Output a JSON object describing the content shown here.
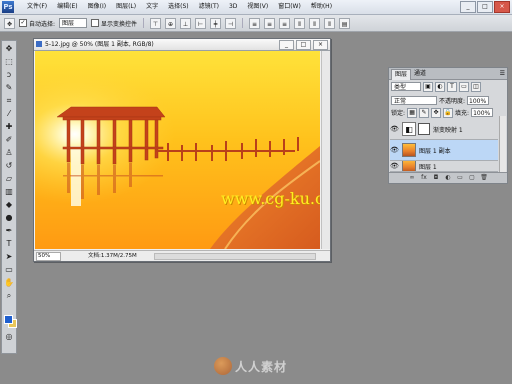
{
  "app": {
    "logo": "Ps",
    "menu": [
      "文件(F)",
      "编辑(E)",
      "图像(I)",
      "图层(L)",
      "文字",
      "选择(S)",
      "滤镜(T)",
      "3D",
      "视图(V)",
      "窗口(W)",
      "帮助(H)"
    ],
    "window_controls": [
      "_",
      "□",
      "×"
    ]
  },
  "options_bar": {
    "auto_select_label": "自动选择:",
    "auto_select_value": "图层",
    "show_transform_label": "显示变换控件"
  },
  "document": {
    "title": "5-12.jpg @ 50% (图层 1 副本, RGB/8)",
    "zoom": "50%",
    "status": "文档:1.37M/2.75M",
    "watermark": "www.cg-ku.com",
    "controls": [
      "_",
      "□",
      "×"
    ]
  },
  "layers_panel": {
    "tabs": [
      "图层",
      "通道"
    ],
    "kind_filter": "类型",
    "blend_mode": "正常",
    "opacity_label": "不透明度:",
    "opacity_value": "100%",
    "lock_label": "锁定:",
    "fill_label": "填充:",
    "fill_value": "100%",
    "layers": [
      {
        "name": "渐变映射 1",
        "type": "adjustment",
        "visible": true,
        "selected": false
      },
      {
        "name": "图层 1 副本",
        "type": "image",
        "visible": true,
        "selected": true
      },
      {
        "name": "图层 1",
        "type": "image",
        "visible": true,
        "selected": false
      }
    ]
  },
  "footer_watermark": "人人素材",
  "colors": {
    "foreground": "#1f5fce",
    "background": "#e9c75a",
    "workspace": "#8b8b8b"
  },
  "icons": {
    "toolbox": [
      "move-icon",
      "marquee-icon",
      "lasso-icon",
      "quick-select-icon",
      "crop-icon",
      "eyedropper-icon",
      "healing-icon",
      "brush-icon",
      "clone-stamp-icon",
      "history-brush-icon",
      "eraser-icon",
      "gradient-icon",
      "blur-icon",
      "dodge-icon",
      "pen-icon",
      "type-icon",
      "path-select-icon",
      "shape-icon",
      "hand-icon",
      "zoom-icon"
    ]
  }
}
